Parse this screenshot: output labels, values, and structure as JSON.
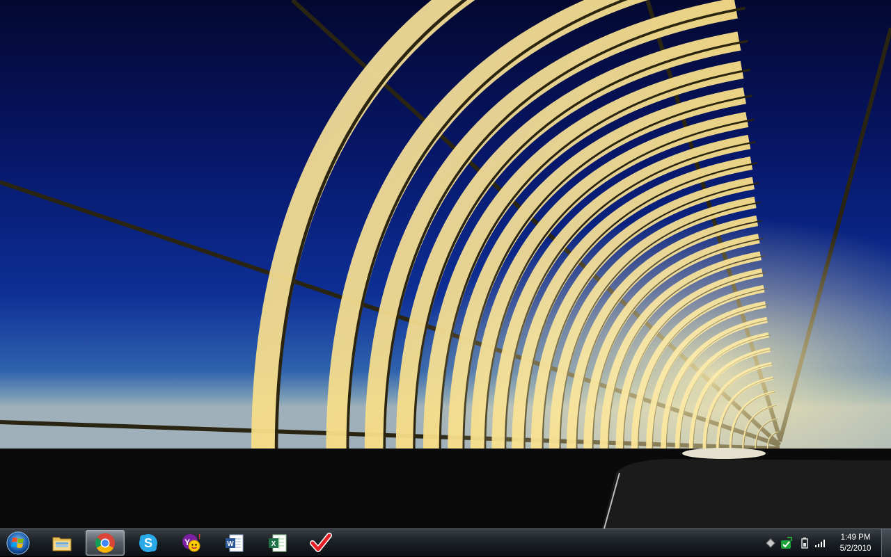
{
  "desktop": {
    "wallpaper": {
      "subject": "illuminated bridge arches against dusk sky",
      "colors": {
        "sky_top": "#050b3a",
        "sky_mid": "#0b2890",
        "sky_horizon": "#5e86a8",
        "arch": "#f3d27a",
        "ground": "#0a0a0a"
      }
    }
  },
  "taskbar": {
    "start_button": {
      "icon": "windows-logo-icon"
    },
    "pinned": [
      {
        "name": "Windows Explorer",
        "icon": "folder-icon",
        "active": false
      },
      {
        "name": "Google Chrome",
        "icon": "chrome-icon",
        "active": true
      },
      {
        "name": "Skype",
        "icon": "skype-icon",
        "active": false
      },
      {
        "name": "Yahoo! Messenger",
        "icon": "yahoo-messenger-icon",
        "active": false
      },
      {
        "name": "Microsoft Word",
        "icon": "word-icon",
        "active": false
      },
      {
        "name": "Microsoft Excel",
        "icon": "excel-icon",
        "active": false
      },
      {
        "name": "Todo list",
        "icon": "checkmark-icon",
        "active": false
      }
    ],
    "tray": {
      "icons": [
        "diamond-icon",
        "sync-check-icon",
        "battery-icon",
        "signal-strength-icon"
      ]
    },
    "clock": {
      "time": "1:49 PM",
      "date": "5/2/2010"
    }
  }
}
